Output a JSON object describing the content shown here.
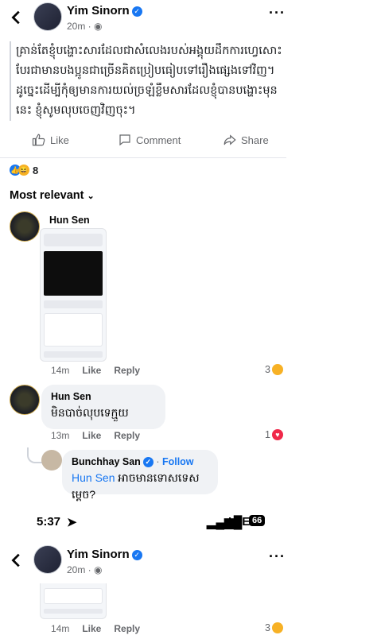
{
  "post": {
    "author": "Yim Sinorn",
    "time": "20m",
    "text": "គ្រាន់តែខ្ញុំបង្ហោះសារដែលជាសំលេងរបស់អង្គុយដឹកការហេ្វសោះ បែរជាមានបងប្អូនជាច្រើនគិតប្រៀបធៀបទៅរឿងផ្សេងទៅវិញ។ ដូចេ្នះដើម្បីកុំឲ្យមានការយល់ច្រឡំខ្លឹមសារដែលខ្ញុំបានបង្ហោះមុននេះ ខ្ញុំសូមលុបចេញវិញចុះ។",
    "reaction_count": "8"
  },
  "actions": {
    "like": "Like",
    "comment": "Comment",
    "share": "Share"
  },
  "sort_label": "Most relevant",
  "comments": [
    {
      "author": "Hun Sen",
      "time": "14m",
      "like": "Like",
      "reply": "Reply",
      "reactions": "3"
    },
    {
      "author": "Hun Sen",
      "text": "មិនបាច់លុបទេក្មួយ",
      "time": "13m",
      "like": "Like",
      "reply": "Reply",
      "reactions": "1"
    }
  ],
  "reply": {
    "author": "Bunchhay San",
    "follow": "Follow",
    "mention": "Hun Sen",
    "text": "អាចមានទោសទេសម្តេច?"
  },
  "status_bar": {
    "time": "5:37",
    "network": "LTE",
    "battery": "66"
  },
  "post_repeat": {
    "author": "Yim Sinorn",
    "time": "20m"
  },
  "comment_repeat": {
    "time": "14m",
    "like": "Like",
    "reply": "Reply",
    "reactions": "3"
  }
}
